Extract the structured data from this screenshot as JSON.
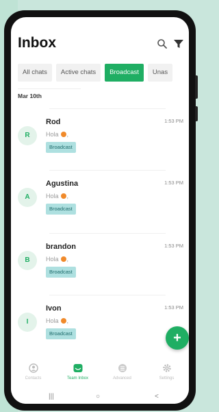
{
  "header": {
    "title": "Inbox",
    "search_icon": "search-icon",
    "filter_icon": "filter-icon"
  },
  "tabs": [
    {
      "label": "All chats",
      "active": false
    },
    {
      "label": "Active chats",
      "active": false
    },
    {
      "label": "Broadcast",
      "active": true
    },
    {
      "label": "Unas",
      "active": false
    }
  ],
  "date_label": "Mar 10th",
  "conversations": [
    {
      "initial": "R",
      "name": "Rod",
      "time": "1:53 PM",
      "message": "Hola",
      "message_suffix": ",",
      "tag": "Broadcast"
    },
    {
      "initial": "A",
      "name": "Agustina",
      "time": "1:53 PM",
      "message": "Hola",
      "message_suffix": ",",
      "tag": "Broadcast"
    },
    {
      "initial": "B",
      "name": "brandon",
      "time": "1:53 PM",
      "message": "Hola",
      "message_suffix": ",",
      "tag": "Broadcast"
    },
    {
      "initial": "I",
      "name": "Ivon",
      "time": "1:53 PM",
      "message": "Hola",
      "message_suffix": ",",
      "tag": "Broadcast"
    }
  ],
  "fab": {
    "label": "+"
  },
  "bottom_nav": [
    {
      "label": "Contacts",
      "icon": "contacts-icon",
      "active": false
    },
    {
      "label": "Team Inbox",
      "icon": "inbox-icon",
      "active": true
    },
    {
      "label": "Advanced",
      "icon": "advanced-icon",
      "active": false
    },
    {
      "label": "Settings",
      "icon": "gear-icon",
      "active": false
    }
  ],
  "system_nav": {
    "recent": "|||",
    "home": "○",
    "back": "<"
  },
  "colors": {
    "accent": "#1fae63",
    "tag_bg": "#aee0e0",
    "background": "#c9e6dc"
  }
}
